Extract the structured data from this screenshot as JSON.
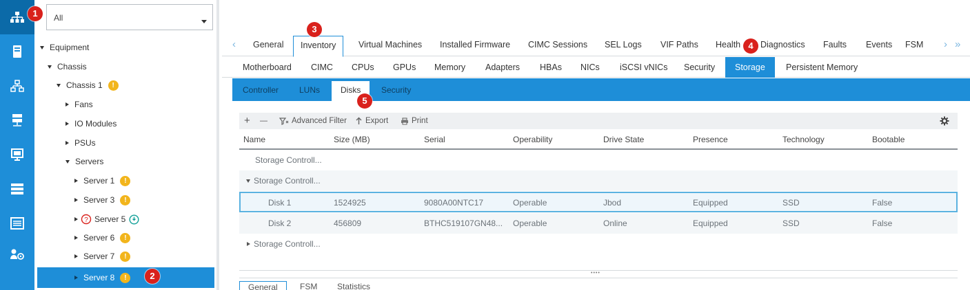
{
  "colors": {
    "accent": "#1e8ed8",
    "callout": "#d9211c",
    "warning": "#f2b51c",
    "info": "#12a098",
    "question": "#d9211c"
  },
  "rail": {
    "items": [
      {
        "name": "network-tree-icon"
      },
      {
        "name": "server-icon"
      },
      {
        "name": "lan-icon"
      },
      {
        "name": "san-icon"
      },
      {
        "name": "vm-icon"
      },
      {
        "name": "storage-icon"
      },
      {
        "name": "chassis-list-icon"
      },
      {
        "name": "admin-icon"
      }
    ]
  },
  "callouts": [
    "1",
    "2",
    "3",
    "4",
    "5"
  ],
  "tree": {
    "filter_value": "All",
    "nodes": [
      {
        "label": "Equipment"
      },
      {
        "label": "Chassis"
      },
      {
        "label": "Chassis 1"
      },
      {
        "label": "Fans"
      },
      {
        "label": "IO Modules"
      },
      {
        "label": "PSUs"
      },
      {
        "label": "Servers"
      },
      {
        "label": "Server 1"
      },
      {
        "label": "Server 3"
      },
      {
        "label": "Server 5"
      },
      {
        "label": "Server 6"
      },
      {
        "label": "Server 7"
      },
      {
        "label": "Server 8"
      }
    ]
  },
  "main_tabs": [
    "General",
    "Inventory",
    "Virtual Machines",
    "Installed Firmware",
    "CIMC Sessions",
    "SEL Logs",
    "VIF Paths",
    "Health",
    "Diagnostics",
    "Faults",
    "Events",
    "FSM"
  ],
  "sub_tabs": [
    "Motherboard",
    "CIMC",
    "CPUs",
    "GPUs",
    "Memory",
    "Adapters",
    "HBAs",
    "NICs",
    "iSCSI vNICs",
    "Security",
    "Storage",
    "Persistent Memory"
  ],
  "storage_tabs": [
    "Controller",
    "LUNs",
    "Disks",
    "Security"
  ],
  "toolbar": {
    "add": "+",
    "remove": "—",
    "advanced_filter": "Advanced Filter",
    "export": "Export",
    "print": "Print"
  },
  "grid": {
    "columns": [
      "Name",
      "Size (MB)",
      "Serial",
      "Operability",
      "Drive State",
      "Presence",
      "Technology",
      "Bootable"
    ],
    "groups": [
      "Storage Controll...",
      "Storage Controll...",
      "Storage Controll..."
    ],
    "rows": [
      [
        "Disk 1",
        "1524925",
        "9080A00NTC17",
        "Operable",
        "Jbod",
        "Equipped",
        "SSD",
        "False"
      ],
      [
        "Disk 2",
        "456809",
        "BTHC519107GN48...",
        "Operable",
        "Online",
        "Equipped",
        "SSD",
        "False"
      ]
    ]
  },
  "bottom_tabs": [
    "General",
    "FSM",
    "Statistics"
  ]
}
